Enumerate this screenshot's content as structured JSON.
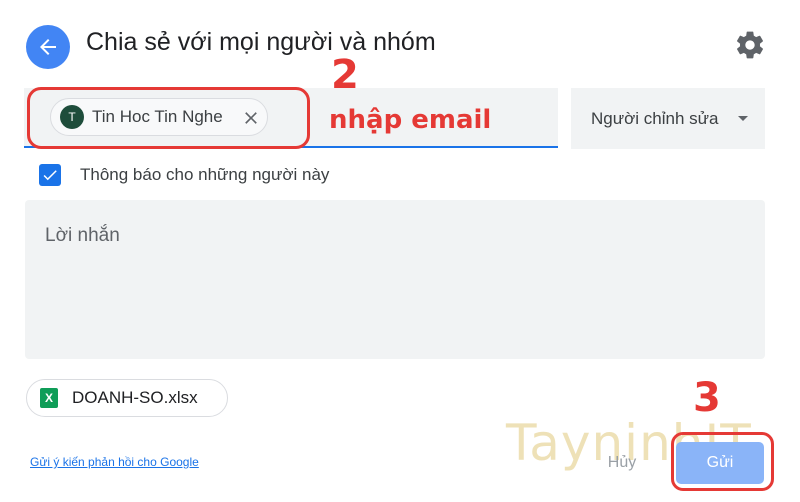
{
  "dialog": {
    "title": "Chia sẻ với mọi người và nhóm",
    "recipient": {
      "avatar_initial": "T",
      "name": "Tin Hoc Tin Nghe"
    },
    "role": "Người chỉnh sửa",
    "notify_label": "Thông báo cho những người này",
    "notify_checked": true,
    "message_placeholder": "Lời nhắn",
    "attachment": {
      "icon": "excel-icon",
      "icon_letter": "X",
      "file_name": "DOANH-SO.xlsx"
    },
    "feedback_link": "Gửi ý kiến phản hồi cho Google",
    "cancel_label": "Hủy",
    "send_label": "Gửi"
  },
  "annotations": {
    "step_2": "2",
    "step_2_text": "nhập email",
    "step_3": "3"
  },
  "watermark": "TayninhIT",
  "colors": {
    "accent": "#1a73e8",
    "back_button": "#4285f4",
    "send_button": "#8ab4f8",
    "annotation": "#e53935"
  },
  "icons": [
    "arrow-back-icon",
    "gear-icon",
    "close-icon",
    "dropdown-caret-icon",
    "check-icon",
    "excel-icon"
  ]
}
